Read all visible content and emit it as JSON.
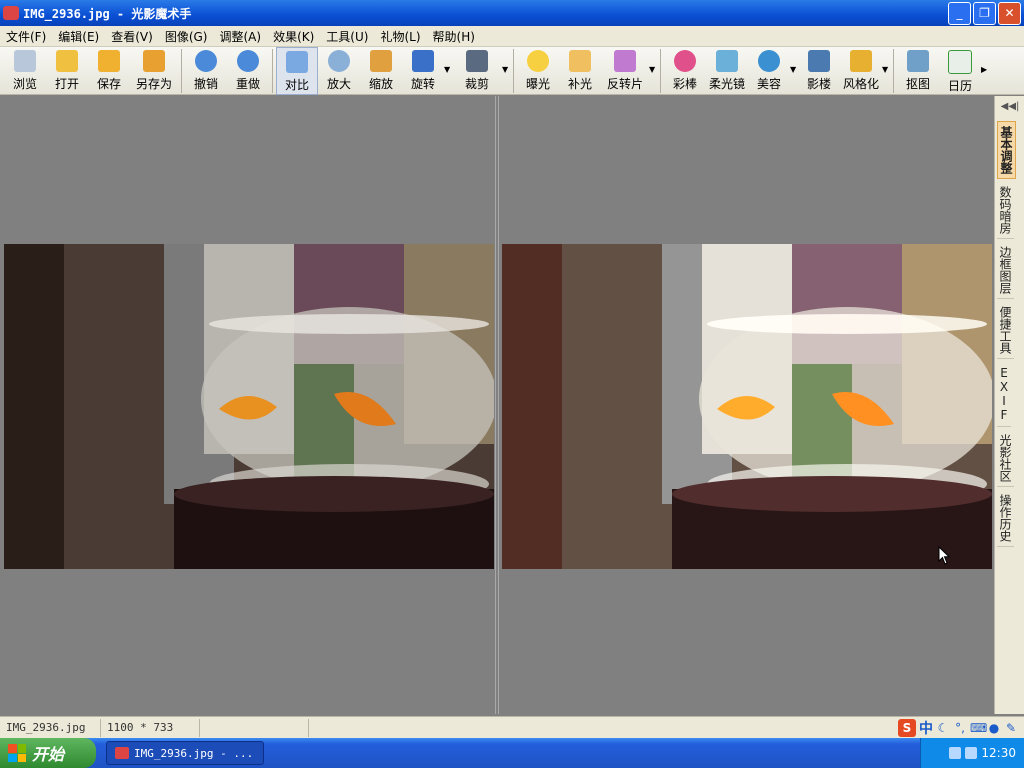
{
  "window": {
    "title": "IMG_2936.jpg - 光影魔术手",
    "min": "_",
    "max": "❐",
    "close": "✕"
  },
  "menu": [
    "文件(F)",
    "编辑(E)",
    "查看(V)",
    "图像(G)",
    "调整(A)",
    "效果(K)",
    "工具(U)",
    "礼物(L)",
    "帮助(H)"
  ],
  "toolbar": {
    "browse": "浏览",
    "open": "打开",
    "save": "保存",
    "save_as": "另存为",
    "undo": "撤销",
    "redo": "重做",
    "compare": "对比",
    "zoom_in": "放大",
    "scale": "缩放",
    "rotate": "旋转",
    "crop": "裁剪",
    "exposure": "曝光",
    "fill_light": "补光",
    "negative": "反转片",
    "color_pen": "彩棒",
    "soft_lens": "柔光镜",
    "beauty": "美容",
    "frame": "影楼",
    "stylize": "风格化",
    "cutout": "抠图",
    "calendar": "日历"
  },
  "colors": {
    "accent": "#0a4fd4",
    "panel": "#808080",
    "tab_active": "#f5d9a8"
  },
  "side_tabs": [
    "基本调整",
    "数码暗房",
    "边框图层",
    "便捷工具",
    "EXIF",
    "光影社区",
    "操作历史"
  ],
  "status": {
    "filename": "IMG_2936.jpg",
    "dimensions": "1100 * 733",
    "ime": "中"
  },
  "taskbar": {
    "start": "开始",
    "task": "IMG_2936.jpg - ...",
    "time": "12:30"
  }
}
